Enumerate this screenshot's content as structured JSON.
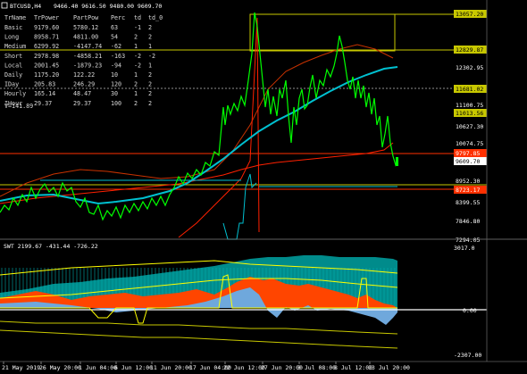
{
  "header": {
    "symbol_tf": "BTCUSD,H4",
    "ohlc": "9466.40 9616.50 9480.00 9609.70"
  },
  "info_table": {
    "columns": [
      "TrName",
      "TrPower",
      "PartPow",
      "Perc",
      "td",
      "td_0"
    ],
    "rows": [
      [
        "Basic",
        "9179.60",
        "5780.12",
        "63",
        "-1",
        "2"
      ],
      [
        "Long",
        "8958.71",
        "4811.00",
        "54",
        "2",
        "2"
      ],
      [
        "Medium",
        "6299.92",
        "-4147.74",
        "-62",
        "1",
        "1"
      ],
      [
        "Short",
        "2978.98",
        "-4858.21",
        "-163",
        "-2",
        "-2"
      ],
      [
        "Local",
        "2001.45",
        "-1879.23",
        "-94",
        "-2",
        "1"
      ],
      [
        "Daily",
        "1175.20",
        "122.22",
        "10",
        "1",
        "2"
      ],
      [
        "IDay",
        "205.83",
        "246.29",
        "120",
        "2",
        "2"
      ],
      [
        "Hourly",
        "165.14",
        "48.47",
        "30",
        "1",
        "2"
      ],
      [
        "IHour",
        "29.37",
        "29.37",
        "100",
        "2",
        "2"
      ]
    ],
    "footer": "V=141.89"
  },
  "price_axis": [
    "13057.20",
    "12829.87",
    "12302.95",
    "11681.02",
    "11100.75",
    "11013.56",
    "10627.30",
    "10074.75",
    "9797.85",
    "9609.70",
    "8952.30",
    "8723.17",
    "8399.55",
    "7846.80",
    "7294.05"
  ],
  "indicator": {
    "label": "SWT 2199.67 -431.44 -726.22",
    "axis": [
      "3017.0",
      "0.00",
      "-2307.00"
    ]
  },
  "time_axis": [
    "21 May 2019",
    "26 May 20:00",
    "1 Jun 04:00",
    "6 Jun 12:00",
    "11 Jun 20:00",
    "17 Jun 04:00",
    "22 Jun 12:00",
    "27 Jun 20:00",
    "3 Jul 08:00",
    "8 Jul 12:00",
    "13 Jul 20:00"
  ],
  "colors": {
    "background": "#000000",
    "candles": "#00ff00",
    "ma_cyan": "#00c0d0",
    "line_red": "#ff0000",
    "line_brown": "#c83200",
    "level_yellow": "#c8c800",
    "hist_teal": "#008b8b",
    "hist_orange": "#ff4500",
    "hist_blue": "#6fa8dc",
    "band_yellow": "#ffff00"
  }
}
